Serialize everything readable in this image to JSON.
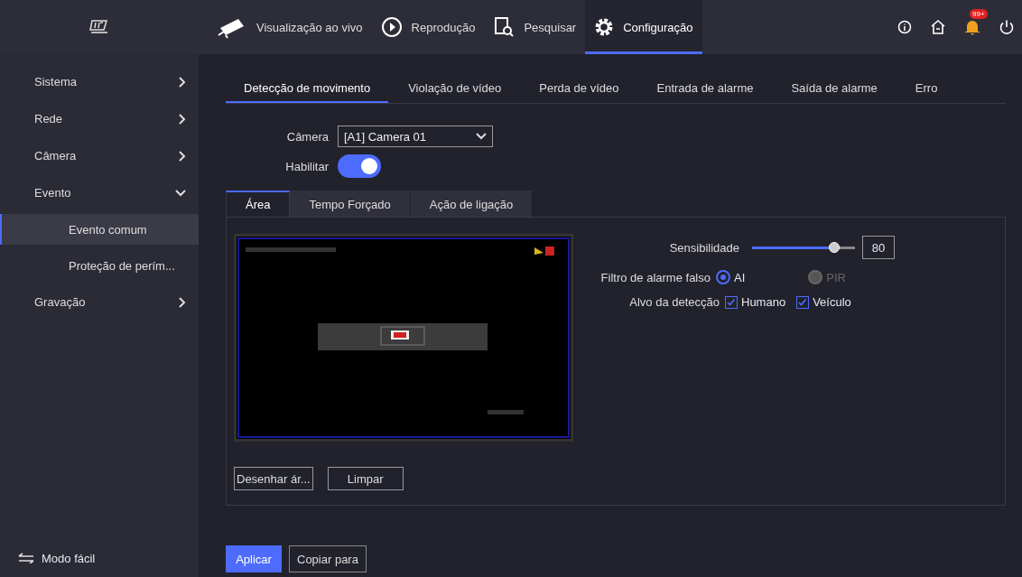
{
  "topbar": {
    "nav": [
      {
        "label": "Visualização ao vivo",
        "selected": false
      },
      {
        "label": "Reprodução",
        "selected": false
      },
      {
        "label": "Pesquisar",
        "selected": false
      },
      {
        "label": "Configuração",
        "selected": true
      }
    ],
    "notification_badge": "99+"
  },
  "sidebar": {
    "items": [
      {
        "label": "Sistema",
        "expanded": false,
        "selected": false
      },
      {
        "label": "Rede",
        "expanded": false,
        "selected": false
      },
      {
        "label": "Câmera",
        "expanded": false,
        "selected": false
      },
      {
        "label": "Evento",
        "expanded": true,
        "selected": false,
        "children": [
          {
            "label": "Evento comum",
            "selected": true
          },
          {
            "label": "Proteção de perím...",
            "selected": false
          }
        ]
      },
      {
        "label": "Gravação",
        "expanded": false,
        "selected": false
      }
    ],
    "footer": "Modo fácil"
  },
  "tabs": [
    {
      "label": "Detecção de movimento",
      "selected": true
    },
    {
      "label": "Violação de vídeo",
      "selected": false
    },
    {
      "label": "Perda de vídeo",
      "selected": false
    },
    {
      "label": "Entrada de alarme",
      "selected": false
    },
    {
      "label": "Saída de alarme",
      "selected": false
    },
    {
      "label": "Erro",
      "selected": false
    }
  ],
  "camera": {
    "label": "Câmera",
    "value": "[A1] Camera 01"
  },
  "enable": {
    "label": "Habilitar",
    "on": true
  },
  "subtabs": [
    {
      "label": "Área",
      "selected": true
    },
    {
      "label": "Tempo Forçado",
      "selected": false
    },
    {
      "label": "Ação de ligação",
      "selected": false
    }
  ],
  "preview": {
    "kind": "picture"
  },
  "sensitivity": {
    "label": "Sensibilidade",
    "level": 0.8,
    "value": "80"
  },
  "false_alarm_filter": {
    "label": "Filtro de alarme falso",
    "options": [
      {
        "label": "AI",
        "selected": true,
        "disabled": false
      },
      {
        "label": "PIR",
        "selected": false,
        "disabled": true
      }
    ]
  },
  "detection_target": {
    "label": "Alvo da detecção",
    "options": [
      {
        "label": "Humano",
        "checked": true
      },
      {
        "label": "Veículo",
        "checked": true
      }
    ]
  },
  "area_buttons": [
    "Desenhar ár...",
    "Limpar"
  ],
  "buttons": [
    {
      "label": "Aplicar",
      "primary": true
    },
    {
      "label": "Copiar para",
      "primary": false
    }
  ]
}
